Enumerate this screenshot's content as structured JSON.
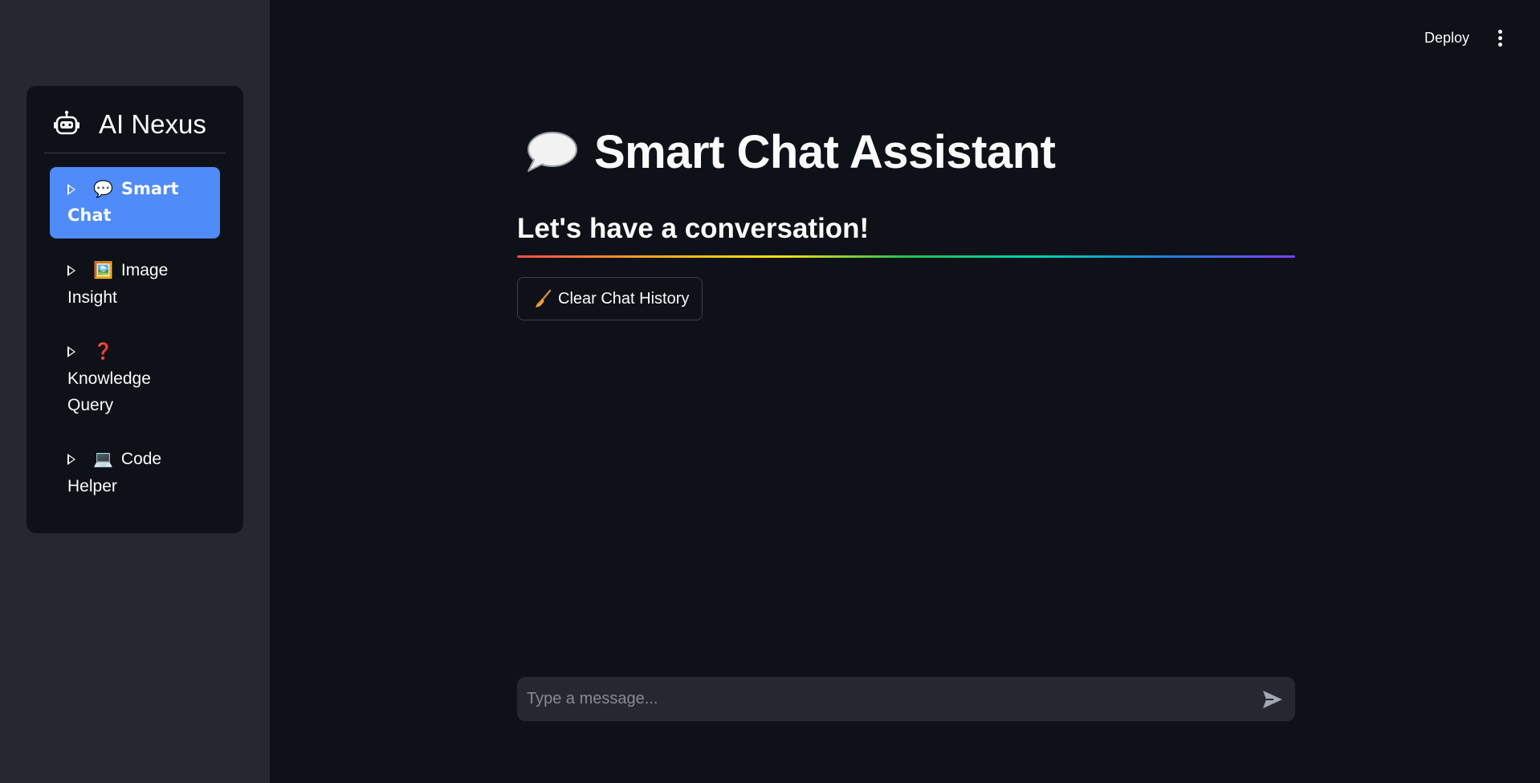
{
  "sidebar": {
    "brand": {
      "title": "AI Nexus",
      "icon": "robot-icon"
    },
    "items": [
      {
        "emoji": "💬",
        "label": "Smart Chat",
        "active": true
      },
      {
        "emoji": "🖼️",
        "label": "Image Insight",
        "active": false
      },
      {
        "emoji": "❓",
        "label": "Knowledge Query",
        "active": false
      },
      {
        "emoji": "💻",
        "label": "Code Helper",
        "active": false
      }
    ]
  },
  "header": {
    "deploy_label": "Deploy",
    "menu_icon": "kebab-menu-icon"
  },
  "main": {
    "title_emoji": "💬",
    "title": "Smart Chat Assistant",
    "subheader": "Let's have a conversation!",
    "clear_button": {
      "emoji": "🧹",
      "label": "Clear Chat History"
    },
    "chat_input": {
      "placeholder": "Type a message...",
      "value": ""
    }
  },
  "colors": {
    "app_bg": "#0e1117",
    "sidebar_bg": "#262730",
    "active_nav": "#4f8bf9",
    "input_bg": "#262730",
    "text": "#fafafa"
  }
}
